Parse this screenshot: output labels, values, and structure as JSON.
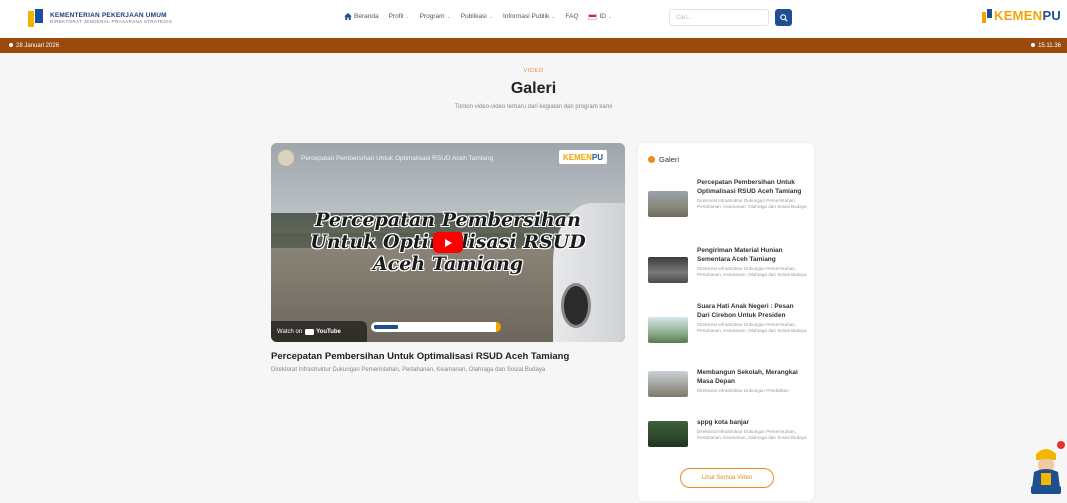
{
  "header": {
    "brand_title": "KEMENTERIAN PEKERJAAN UMUM",
    "brand_sub": "DIREKTORAT JENDERAL PRASARANA STRATEGIS",
    "nav": [
      {
        "label": "Beranda",
        "icon": "home-icon",
        "dropdown": false
      },
      {
        "label": "Profil",
        "dropdown": true
      },
      {
        "label": "Program",
        "dropdown": true
      },
      {
        "label": "Publikasi",
        "dropdown": true
      },
      {
        "label": "Informasi Publik",
        "dropdown": true
      },
      {
        "label": "FAQ",
        "dropdown": false
      }
    ],
    "lang": "ID",
    "search_placeholder": "Cari...",
    "right_logo_a": "KEMEN",
    "right_logo_b": "PU"
  },
  "datebar": {
    "date": "28 Januari 2026",
    "time": "15.11.36"
  },
  "section": {
    "eyebrow": "VIDEO",
    "title": "Galeri",
    "description": "Tonton video-video terbaru dari kegiatan dan program kami"
  },
  "video": {
    "overlay_title": "Percepatan Pembersihan Untuk Optimalisasi RSUD Aceh Tamiang",
    "big_line1": "Percepatan Pembersihan",
    "big_line2": "Untuk Optimalisasi RSUD",
    "big_line3": "Aceh Tamiang",
    "logo_a": "KEMEN",
    "logo_b": "PU",
    "watch_on": "Watch on",
    "youtube": "YouTube",
    "caption_title": "Percepatan Pembersihan Untuk Optimalisasi RSUD Aceh Tamiang",
    "caption_sub": "Direktorat Infrastruktur Dukungan Pemerintahan, Pertahanan, Keamanan, Olahraga dan Sosial Budaya"
  },
  "sidebar": {
    "heading": "Galeri",
    "items": [
      {
        "title": "Percepatan Pembersihan Untuk Optimalisasi RSUD Aceh Tamiang",
        "sub": "Direktorat Infrastruktur Dukungan Pemerintahan, Pertahanan, Keamanan, Olahraga dan Sosial Budaya"
      },
      {
        "title": "Pengiriman Material Hunian Sementara Aceh Tamiang",
        "sub": "Direktorat Infrastruktur Dukungan Pemerintahan, Pertahanan, Keamanan, Olahraga dan Sosial Budaya"
      },
      {
        "title": "Suara Hati Anak Negeri : Pesan Dari Cirebon Untuk Presiden",
        "sub": "Direktorat Infrastruktur Dukungan Pemerintahan, Pertahanan, Keamanan, Olahraga dan Sosial Budaya"
      },
      {
        "title": "Membangun Sekolah, Merangkai Masa Depan",
        "sub": "Direktorat Infrastruktur Dukungan Pendidikan"
      },
      {
        "title": "sppg kota banjar",
        "sub": "Direktorat Infrastruktur Dukungan Pemerintahan, Pertahanan, Keamanan, Olahraga dan Sosial Budaya"
      }
    ],
    "more_button": "Lihat Semua Video"
  },
  "colors": {
    "brand_blue": "#1d4f91",
    "brand_orange": "#ef8a22",
    "datebar": "#9a4a0c"
  }
}
